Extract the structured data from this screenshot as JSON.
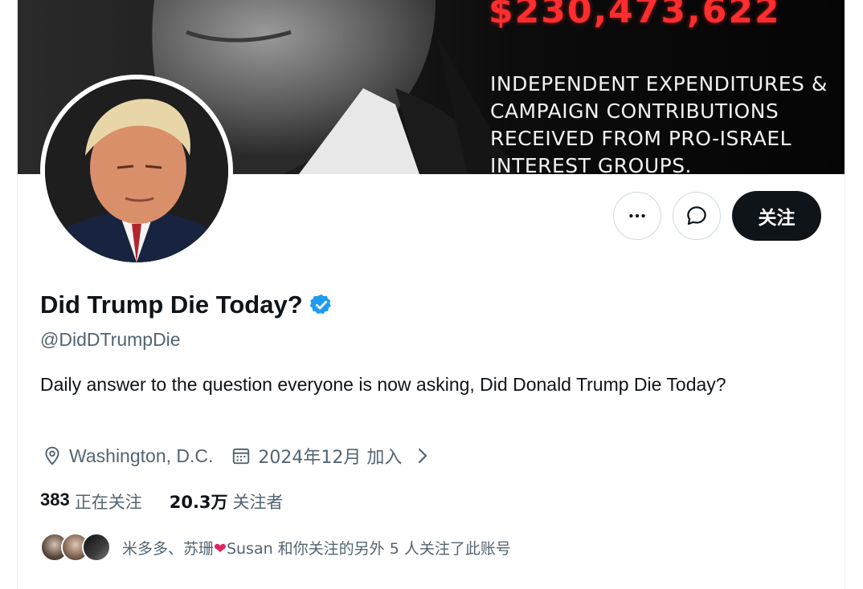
{
  "banner": {
    "amount": "$230,473,622",
    "text": "INDEPENDENT EXPENDITURES & CAMPAIGN CONTRIBUTIONS RECEIVED FROM PRO-ISRAEL INTEREST GROUPS."
  },
  "actions": {
    "more_icon": "more-horizontal-icon",
    "message_icon": "message-bubble-icon",
    "follow_label": "关注"
  },
  "profile": {
    "display_name": "Did Trump Die Today?",
    "verified": true,
    "verified_color": "#1d9bf0",
    "handle": "@DidDTrumpDie",
    "bio": "Daily answer to the question everyone is now asking, Did Donald Trump Die Today?",
    "location": "Washington, D.C.",
    "joined": "2024年12月 加入"
  },
  "stats": {
    "following_count": "383",
    "following_label": "正在关注",
    "followers_count": "20.3万",
    "followers_label": "关注者"
  },
  "followed_by": {
    "text_prefix": "米多多、苏珊",
    "text_suffix": "Susan 和你关注的另外 5 人关注了此账号"
  }
}
